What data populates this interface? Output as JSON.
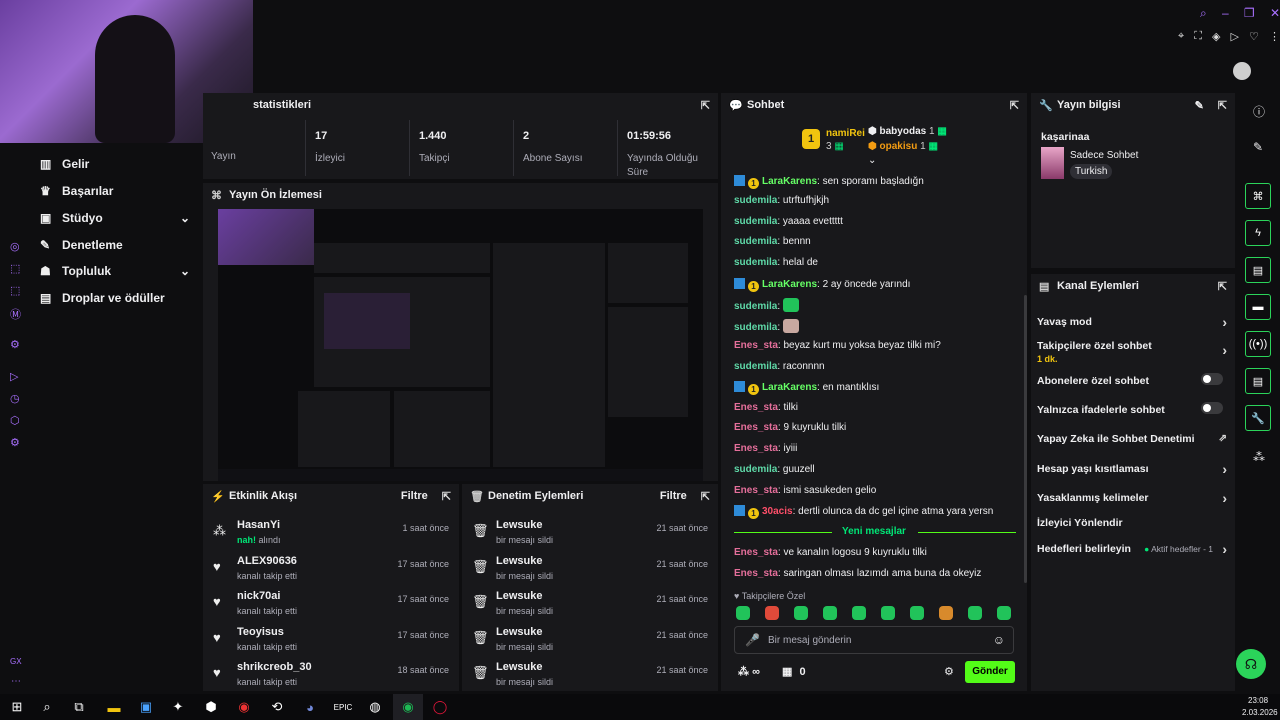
{
  "left_nav": {
    "items": [
      {
        "label": "Gelir",
        "icon": "chart-icon"
      },
      {
        "label": "Başarılar",
        "icon": "trophy-icon"
      },
      {
        "label": "Stüdyo",
        "icon": "studio-icon"
      },
      {
        "label": "Denetleme",
        "icon": "wrench-icon"
      },
      {
        "label": "Topluluk",
        "icon": "people-icon"
      },
      {
        "label": "Droplar ve ödüller",
        "icon": "drops-icon"
      }
    ],
    "gx_label": "GX"
  },
  "stats": {
    "title": "statistikleri",
    "items": [
      {
        "value": "",
        "label": "Yayın"
      },
      {
        "value": "17",
        "label": "İzleyici"
      },
      {
        "value": "1.440",
        "label": "Takipçi"
      },
      {
        "value": "2",
        "label": "Abone Sayısı"
      },
      {
        "value": "01:59:56",
        "label": "Yayında Olduğu Süre"
      }
    ]
  },
  "preview": {
    "title": "Yayın Ön İzlemesi"
  },
  "activity": {
    "title": "Etkinlik Akışı",
    "filter": "Filtre",
    "rows": [
      {
        "name": "HasanYi",
        "sub_accent": "nah!",
        "sub": " alındı",
        "time": "1 saat önce",
        "icon": "points-icon"
      },
      {
        "name": "ALEX90636",
        "sub_accent": "",
        "sub": "kanalı takip etti",
        "time": "17 saat önce",
        "icon": "heart-icon"
      },
      {
        "name": "nick70ai",
        "sub_accent": "",
        "sub": "kanalı takip etti",
        "time": "17 saat önce",
        "icon": "heart-icon"
      },
      {
        "name": "Teoyisus",
        "sub_accent": "",
        "sub": "kanalı takip etti",
        "time": "17 saat önce",
        "icon": "heart-icon"
      },
      {
        "name": "shrikcreob_30",
        "sub_accent": "",
        "sub": "kanalı takip etti",
        "time": "18 saat önce",
        "icon": "heart-icon"
      }
    ]
  },
  "moderation": {
    "title": "Denetim Eylemleri",
    "filter": "Filtre",
    "rows": [
      {
        "name": "Lewsuke",
        "sub": "bir mesajı sildi",
        "time": "21 saat önce"
      },
      {
        "name": "Lewsuke",
        "sub": "bir mesajı sildi",
        "time": "21 saat önce"
      },
      {
        "name": "Lewsuke",
        "sub": "bir mesajı sildi",
        "time": "21 saat önce"
      },
      {
        "name": "Lewsuke",
        "sub": "bir mesajı sildi",
        "time": "21 saat önce"
      },
      {
        "name": "Lewsuke",
        "sub": "bir mesajı sildi",
        "time": "21 saat önce"
      }
    ]
  },
  "chat": {
    "title": "Sohbet",
    "leaderboard": {
      "first_name": "namiRei",
      "first_count": "3",
      "first_rank": "1",
      "second_name": "babyodas",
      "second_count": "1",
      "third_name": "opakisu",
      "third_count": "1"
    },
    "messages": [
      {
        "user": "LaraKarens",
        "style": "u-gr",
        "badges": true,
        "text": " sen sporamı başladığn"
      },
      {
        "user": "sudemila",
        "style": "u-g",
        "badges": false,
        "text": " utrftufhjkjh"
      },
      {
        "user": "sudemila",
        "style": "u-g",
        "badges": false,
        "text": " yaaaa evettttt"
      },
      {
        "user": "sudemila",
        "style": "u-g",
        "badges": false,
        "text": " bennn"
      },
      {
        "user": "sudemila",
        "style": "u-g",
        "badges": false,
        "text": " helal de"
      },
      {
        "user": "LaraKarens",
        "style": "u-gr",
        "badges": true,
        "text": " 2 ay öncede yarındı"
      },
      {
        "user": "sudemila",
        "style": "u-g",
        "badges": false,
        "text": " "
      },
      {
        "user": "sudemila",
        "style": "u-g",
        "badges": false,
        "text": " "
      },
      {
        "user": "Enes_sta",
        "style": "u-p",
        "badges": false,
        "text": " beyaz kurt mu yoksa beyaz tilki mi?"
      },
      {
        "user": "sudemila",
        "style": "u-g",
        "badges": false,
        "text": " raconnnn"
      },
      {
        "user": "LaraKarens",
        "style": "u-gr",
        "badges": true,
        "text": " en mantıklısı"
      },
      {
        "user": "Enes_sta",
        "style": "u-p",
        "badges": false,
        "text": " tilki"
      },
      {
        "user": "Enes_sta",
        "style": "u-p",
        "badges": false,
        "text": " 9 kuyruklu tilki"
      },
      {
        "user": "Enes_sta",
        "style": "u-p",
        "badges": false,
        "text": " iyiii"
      },
      {
        "user": "sudemila",
        "style": "u-g",
        "badges": false,
        "text": " guuzell"
      },
      {
        "user": "Enes_sta",
        "style": "u-p",
        "badges": false,
        "text": " ismi sasukeden gelio"
      },
      {
        "user": "30acis",
        "style": "u-r",
        "badges": true,
        "text": " dertli olunca da dc gel içine atma yara yersn"
      }
    ],
    "new_messages_label": "Yeni mesajlar",
    "messages_after": [
      {
        "user": "Enes_sta",
        "style": "u-p",
        "text": " ve kanalın logosu 9 kuyruklu tilki"
      },
      {
        "user": "Enes_sta",
        "style": "u-p",
        "text": " saringan olması lazımdı ama buna da okeyiz"
      }
    ],
    "followers_only_label": "Takipçilere Özel",
    "input_placeholder": "Bir mesaj gönderin",
    "points": "∞",
    "gift_count": "0",
    "send_label": "Gönder"
  },
  "stream_info": {
    "title": "Yayın bilgisi",
    "stream_title": "kaşarinaa",
    "category": "Sadece Sohbet",
    "tag": "Turkish"
  },
  "channel_actions": {
    "title": "Kanal Eylemleri",
    "items": [
      {
        "label": "Yavaş mod",
        "control": "arrow"
      },
      {
        "label": "Takipçilere özel sohbet",
        "sub": "1 dk.",
        "control": "arrow"
      },
      {
        "label": "Abonelere özel sohbet",
        "control": "toggle"
      },
      {
        "label": "Yalnızca ifadelerle sohbet",
        "control": "toggle"
      },
      {
        "label": "Yapay Zeka ile Sohbet Denetimi",
        "control": "external"
      },
      {
        "label": "Hesap yaşı kısıtlaması",
        "control": "arrow"
      },
      {
        "label": "Yasaklanmış kelimeler",
        "control": "arrow"
      },
      {
        "label": "İzleyici Yönlendir",
        "control": "none"
      },
      {
        "label": "Hedefleri belirleyin",
        "extra": "Aktif hedefler - 1",
        "control": "arrow"
      }
    ]
  },
  "taskbar": {
    "time": "23:08",
    "date": "2.03.2026"
  },
  "colors": {
    "accent": "#53fc18",
    "bg": "#0e0e10",
    "panel": "#18181b"
  }
}
